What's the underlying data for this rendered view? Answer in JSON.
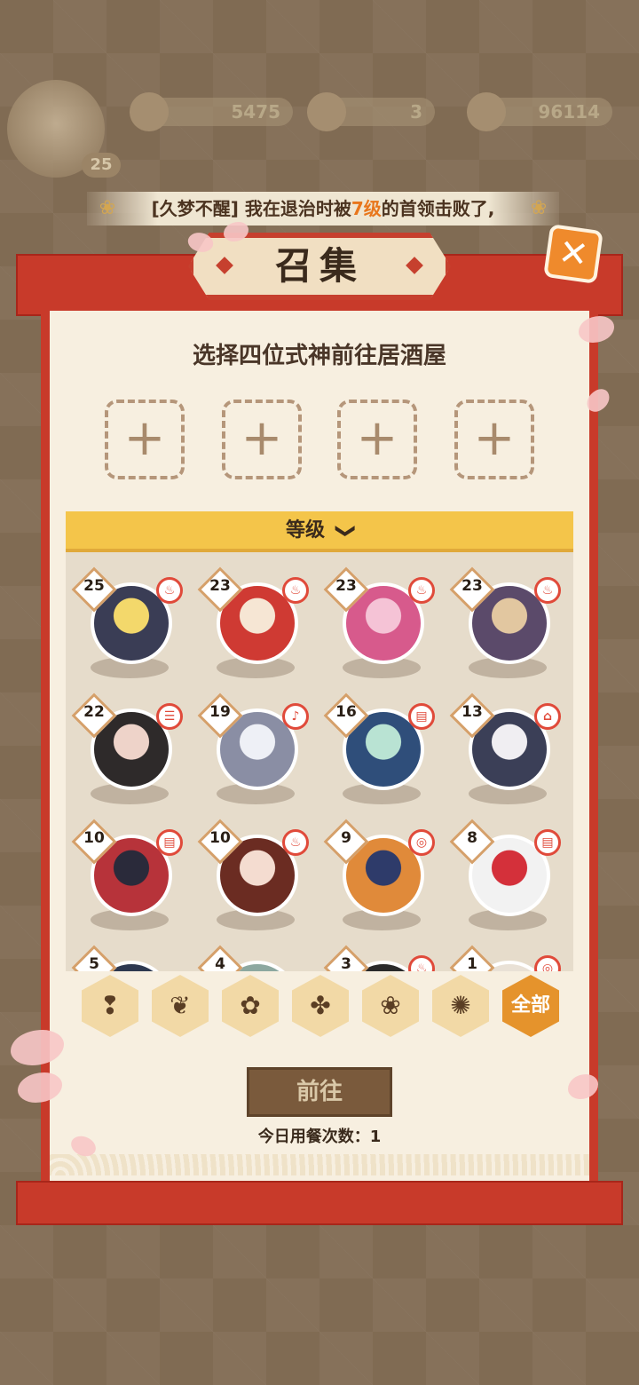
{
  "hud": {
    "player_level": "25",
    "resources": [
      "5475",
      "3",
      "96114"
    ]
  },
  "notice": {
    "prefix": "[久梦不醒] 我在退治时被",
    "highlight": "7级",
    "suffix": "的首领击败了,"
  },
  "dialog": {
    "title": "召集",
    "close_label": "✕",
    "subtitle": "选择四位式神前往居酒屋",
    "slot_plus": "+",
    "sort_label": "等级",
    "sort_chevron": "❯"
  },
  "shikigami": [
    {
      "level": "25",
      "tag": "♨",
      "color": "#3a3d55",
      "accent": "#f3d86b"
    },
    {
      "level": "23",
      "tag": "♨",
      "color": "#cf3a33",
      "accent": "#f6e6d4"
    },
    {
      "level": "23",
      "tag": "♨",
      "color": "#d75a8c",
      "accent": "#f5c3d6"
    },
    {
      "level": "23",
      "tag": "♨",
      "color": "#5b4a6a",
      "accent": "#e2c7a0"
    },
    {
      "level": "22",
      "tag": "☰",
      "color": "#2e2a2a",
      "accent": "#eed3c9"
    },
    {
      "level": "19",
      "tag": "♪",
      "color": "#8a8ea4",
      "accent": "#eef0f6"
    },
    {
      "level": "16",
      "tag": "▤",
      "color": "#2f4e7a",
      "accent": "#b9e3d3"
    },
    {
      "level": "13",
      "tag": "⌂",
      "color": "#3b3f57",
      "accent": "#f0eef2"
    },
    {
      "level": "10",
      "tag": "▤",
      "color": "#b7333a",
      "accent": "#2a2a3a"
    },
    {
      "level": "10",
      "tag": "♨",
      "color": "#6b2c22",
      "accent": "#f4dcd0"
    },
    {
      "level": "9",
      "tag": "◎",
      "color": "#e08a3a",
      "accent": "#2e3b6a"
    },
    {
      "level": "8",
      "tag": "▤",
      "color": "#f2f2f2",
      "accent": "#d4303a"
    },
    {
      "level": "5",
      "tag": "",
      "color": "#2d3850",
      "accent": "#e6e0d8"
    },
    {
      "level": "4",
      "tag": "",
      "color": "#8da8a0",
      "accent": "#e6e0d8"
    },
    {
      "level": "3",
      "tag": "♨",
      "color": "#2a2a2a",
      "accent": "#d94a3a"
    },
    {
      "level": "1",
      "tag": "◎",
      "color": "#e9e1d6",
      "accent": "#c9b9a0"
    }
  ],
  "rarity_filters": [
    "❢",
    "❦",
    "✿",
    "✤",
    "❀",
    "✺",
    "全部"
  ],
  "actions": {
    "go_label": "前往",
    "meal_count_label": "今日用餐次数：",
    "meal_count_value": "1"
  }
}
